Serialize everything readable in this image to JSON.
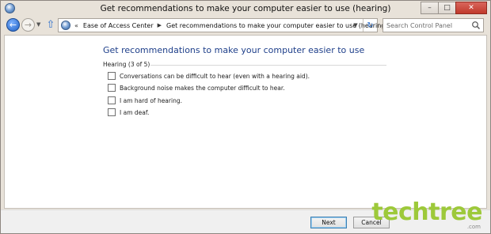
{
  "window": {
    "title": "Get recommendations to make your computer easier to use (hearing)",
    "buttons": {
      "minimize": "–",
      "maximize": "□",
      "close": "✕"
    }
  },
  "nav": {
    "back_icon": "back-arrow-icon",
    "forward_icon": "forward-arrow-icon",
    "history_icon": "history-dropdown-icon",
    "up_icon": "up-arrow-icon",
    "address": {
      "breadcrumbs": [
        "Ease of Access Center",
        "Get recommendations to make your computer easier to use (hearing)"
      ]
    },
    "search": {
      "placeholder": "Search Control Panel"
    }
  },
  "main": {
    "heading": "Get recommendations to make your computer easier to use",
    "group_label": "Hearing (3 of 5)",
    "options": [
      {
        "label": "Conversations can be difficult to hear (even with a hearing aid).",
        "checked": false
      },
      {
        "label": "Background noise makes the computer difficult to hear.",
        "checked": false
      },
      {
        "label": "I am hard of hearing.",
        "checked": false
      },
      {
        "label": "I am deaf.",
        "checked": false
      }
    ]
  },
  "footer": {
    "next_label": "Next",
    "cancel_label": "Cancel"
  },
  "watermark": {
    "text": "techtree",
    "sub": ".com"
  },
  "colors": {
    "heading": "#1e3f8a",
    "accent_blue": "#1d5fc4",
    "close_red": "#c0392b",
    "watermark_green": "#9dc93a"
  }
}
